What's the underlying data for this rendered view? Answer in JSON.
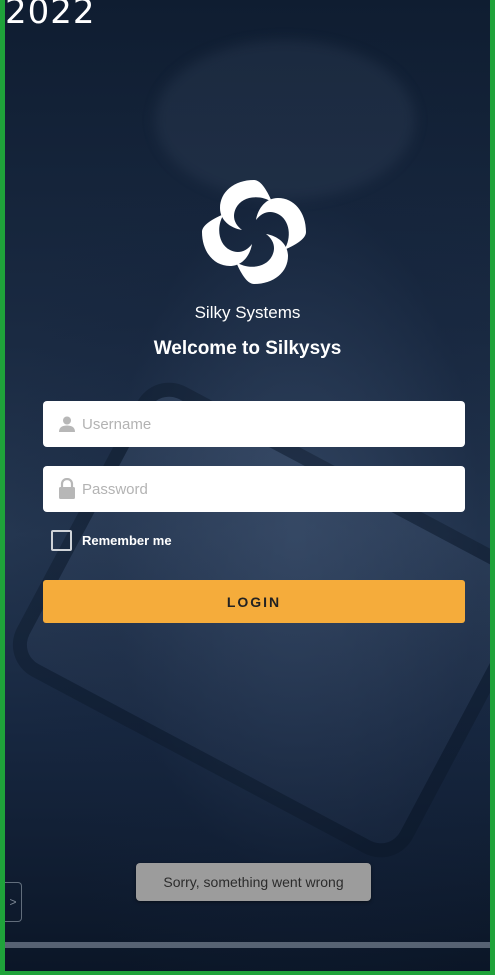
{
  "overlay": {
    "year": "2022"
  },
  "brand": {
    "name": "Silky Systems",
    "welcome": "Welcome to Silkysys",
    "logo_icon": "silky-swirl-logo"
  },
  "form": {
    "username": {
      "placeholder": "Username",
      "value": "",
      "icon": "user-icon"
    },
    "password": {
      "placeholder": "Password",
      "value": "",
      "icon": "lock-icon"
    },
    "remember": {
      "label": "Remember me",
      "checked": false
    },
    "login_label": "LOGIN"
  },
  "toast": {
    "message": "Sorry, something went wrong"
  },
  "side_tab": {
    "glyph": ">"
  },
  "colors": {
    "accent": "#f5ac3b",
    "frame_border": "#1fa33a",
    "background": "#12213a",
    "toast_bg": "#9c9c9c"
  }
}
